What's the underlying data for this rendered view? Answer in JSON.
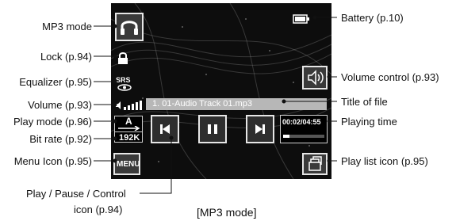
{
  "callouts": {
    "mp3_mode": "MP3 mode",
    "lock": "Lock (p.94)",
    "equalizer": "Equalizer (p.95)",
    "volume": "Volume (p.93)",
    "play_mode": "Play mode (p.96)",
    "bit_rate": "Bit rate (p.92)",
    "menu_icon": "Menu Icon (p.95)",
    "play_control_1": "Play / Pause / Control",
    "play_control_2": "icon (p.94)",
    "battery": "Battery (p.10)",
    "volume_control": "Volume control (p.93)",
    "title_of_file": "Title of file",
    "playing_time": "Playing time",
    "play_list_icon": "Play list icon (p.95)"
  },
  "caption": "[MP3 mode]",
  "screen": {
    "eq_label": "SRS",
    "track_title": "1. 01-Audio Track 01.mp3",
    "play_mode_letter": "A",
    "bit_rate": "192K",
    "time": "00:02/04:55",
    "menu_label": "MENU",
    "progress": 0.15
  },
  "colors": {
    "screen_bg": "#0d0d0d",
    "title_bar": "#b7b7b7",
    "button_bg": "#2e2e2e",
    "line": "#111111"
  },
  "icons": [
    "headphones-icon",
    "lock-icon",
    "srs-icon",
    "volume-bars-icon",
    "repeat-a-icon",
    "previous-icon",
    "pause-icon",
    "next-icon",
    "battery-icon",
    "speaker-icon",
    "playlist-icon"
  ]
}
